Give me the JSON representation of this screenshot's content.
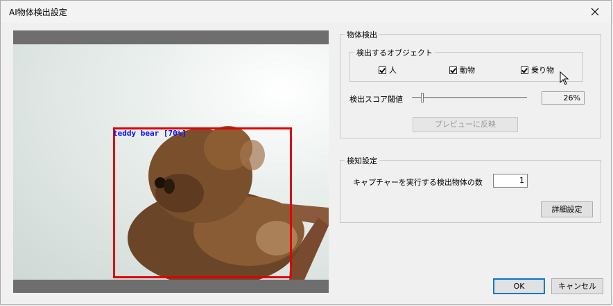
{
  "window": {
    "title": "AI物体検出設定"
  },
  "preview": {
    "detection_label": "teddy bear [70%]"
  },
  "detection_group": {
    "title": "物体検出",
    "objects_group": {
      "title": "検出するオブジェクト",
      "items": [
        {
          "label": "人",
          "checked": true
        },
        {
          "label": "動物",
          "checked": true
        },
        {
          "label": "乗り物",
          "checked": true
        }
      ]
    },
    "threshold_label": "検出スコア閾値",
    "threshold_value": "26%",
    "threshold_level": 0.26,
    "preview_button": "プレビューに反映"
  },
  "notify_group": {
    "title": "検知設定",
    "count_label": "キャプチャーを実行する検出物体の数",
    "count_value": "1",
    "details_button": "詳細設定"
  },
  "footer": {
    "ok": "OK",
    "cancel": "キャンセル"
  },
  "colors": {
    "detection_box": "#e00000",
    "label_text": "#0a0aff"
  }
}
